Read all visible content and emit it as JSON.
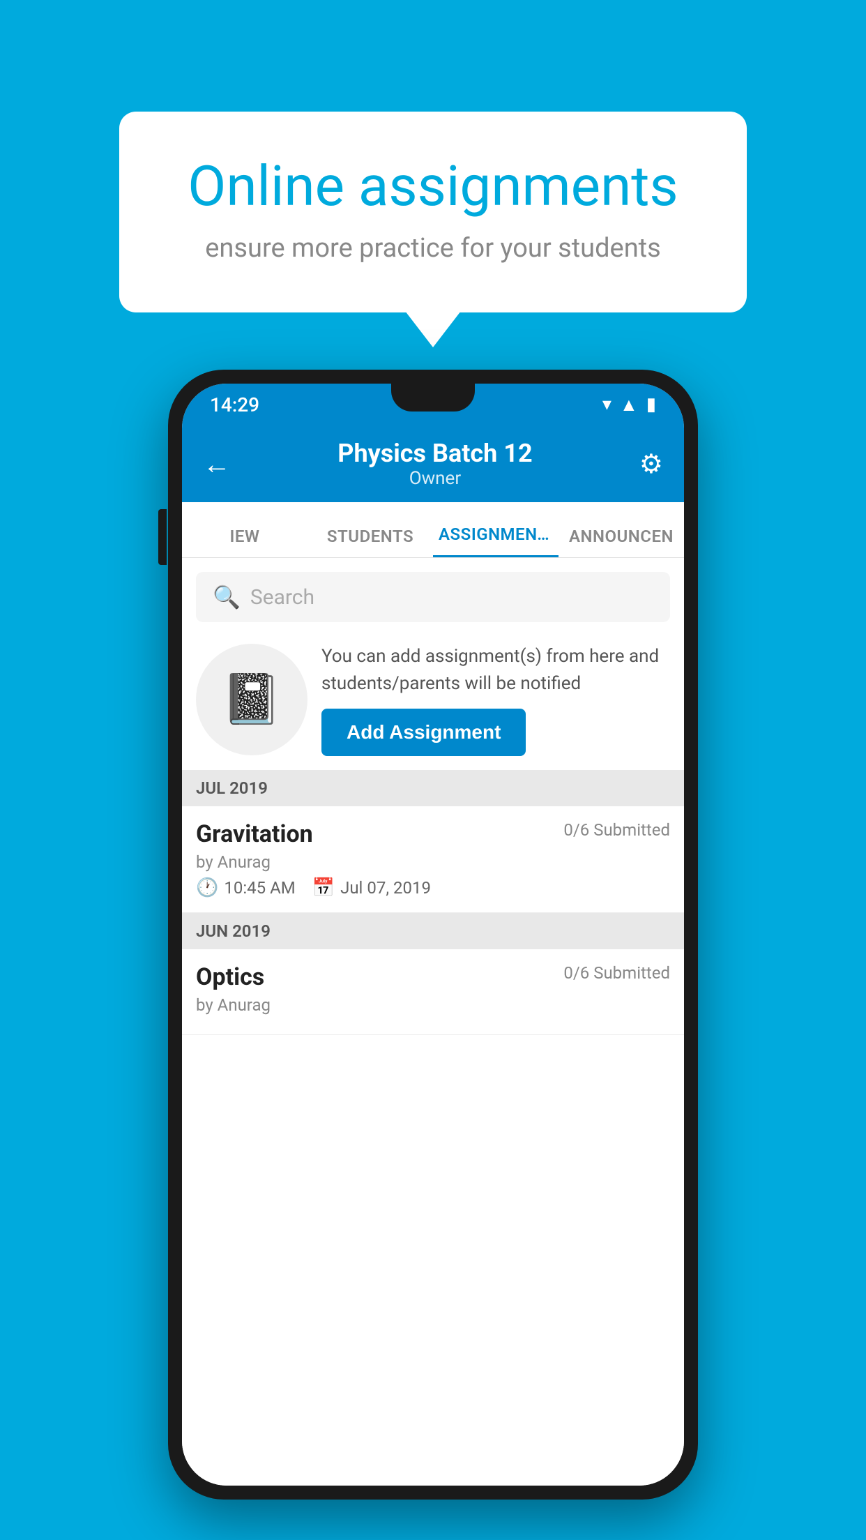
{
  "background_color": "#00AADD",
  "promo": {
    "title": "Online assignments",
    "subtitle": "ensure more practice for your students"
  },
  "status_bar": {
    "time": "14:29",
    "icons": [
      "wifi",
      "signal",
      "battery"
    ]
  },
  "app_bar": {
    "title": "Physics Batch 12",
    "subtitle": "Owner",
    "back_label": "←",
    "gear_label": "⚙"
  },
  "tabs": [
    {
      "label": "IEW",
      "active": false
    },
    {
      "label": "STUDENTS",
      "active": false
    },
    {
      "label": "ASSIGNMENTS",
      "active": true
    },
    {
      "label": "ANNOUNCEM…",
      "active": false
    }
  ],
  "search": {
    "placeholder": "Search"
  },
  "info_banner": {
    "icon": "📓",
    "text": "You can add assignment(s) from here and students/parents will be notified",
    "button_label": "Add Assignment"
  },
  "sections": [
    {
      "header": "JUL 2019",
      "assignments": [
        {
          "name": "Gravitation",
          "submitted": "0/6 Submitted",
          "by": "by Anurag",
          "time": "10:45 AM",
          "date": "Jul 07, 2019"
        }
      ]
    },
    {
      "header": "JUN 2019",
      "assignments": [
        {
          "name": "Optics",
          "submitted": "0/6 Submitted",
          "by": "by Anurag",
          "time": "",
          "date": ""
        }
      ]
    }
  ]
}
